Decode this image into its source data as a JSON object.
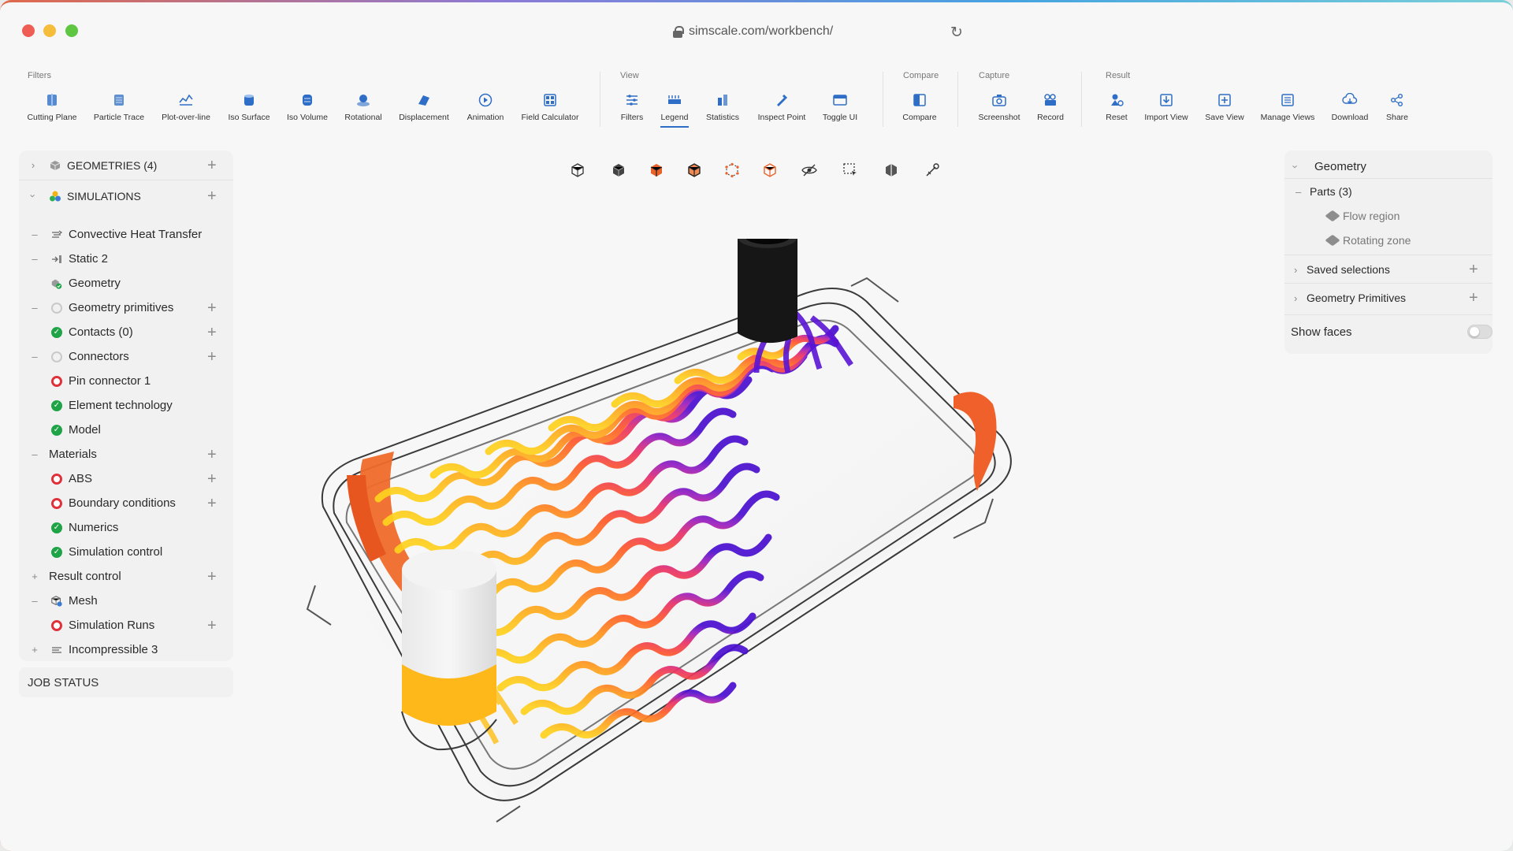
{
  "browser": {
    "url": "simscale.com/workbench/"
  },
  "toolbar": {
    "groups": [
      {
        "title": "Filters",
        "buttons": [
          {
            "label": "Cutting Plane",
            "icon": "cutting-plane-icon"
          },
          {
            "label": "Particle Trace",
            "icon": "particle-trace-icon"
          },
          {
            "label": "Plot-over-line",
            "icon": "plot-over-line-icon"
          },
          {
            "label": "Iso Surface",
            "icon": "iso-surface-icon"
          },
          {
            "label": "Iso Volume",
            "icon": "iso-volume-icon"
          },
          {
            "label": "Rotational",
            "icon": "rotational-icon"
          },
          {
            "label": "Displacement",
            "icon": "displacement-icon"
          },
          {
            "label": "Animation",
            "icon": "animation-icon"
          },
          {
            "label": "Field Calculator",
            "icon": "field-calculator-icon"
          }
        ]
      },
      {
        "title": "View",
        "buttons": [
          {
            "label": "Filters",
            "icon": "filters-icon"
          },
          {
            "label": "Legend",
            "icon": "legend-icon",
            "active": true
          },
          {
            "label": "Statistics",
            "icon": "statistics-icon"
          },
          {
            "label": "Inspect Point",
            "icon": "inspect-point-icon"
          },
          {
            "label": "Toggle UI",
            "icon": "toggle-ui-icon"
          }
        ]
      },
      {
        "title": "Compare",
        "buttons": [
          {
            "label": "Compare",
            "icon": "compare-icon"
          }
        ]
      },
      {
        "title": "Capture",
        "buttons": [
          {
            "label": "Screenshot",
            "icon": "screenshot-icon"
          },
          {
            "label": "Record",
            "icon": "record-icon"
          }
        ]
      },
      {
        "title": "Result",
        "buttons": [
          {
            "label": "Reset",
            "icon": "reset-icon"
          },
          {
            "label": "Import View",
            "icon": "import-view-icon"
          },
          {
            "label": "Save View",
            "icon": "save-view-icon"
          },
          {
            "label": "Manage Views",
            "icon": "manage-views-icon"
          },
          {
            "label": "Download",
            "icon": "download-icon"
          },
          {
            "label": "Share",
            "icon": "share-icon"
          }
        ]
      }
    ]
  },
  "tree": {
    "geometries_label": "GEOMETRIES (4)",
    "simulations_label": "SIMULATIONS",
    "items": [
      {
        "label": "Convective Heat Transfer",
        "status": "sim-type"
      },
      {
        "label": "Static 2",
        "status": "sim-type"
      },
      {
        "label": "Geometry",
        "status": "geometry"
      },
      {
        "label": "Geometry primitives",
        "status": "none"
      },
      {
        "label": "Contacts (0)",
        "status": "ok"
      },
      {
        "label": "Connectors",
        "status": "none"
      },
      {
        "label": "Pin connector 1",
        "status": "error"
      },
      {
        "label": "Element technology",
        "status": "ok"
      },
      {
        "label": "Model",
        "status": "ok"
      },
      {
        "label": "Materials",
        "status": "group"
      },
      {
        "label": "ABS",
        "status": "error"
      },
      {
        "label": "Boundary conditions",
        "status": "error"
      },
      {
        "label": "Numerics",
        "status": "ok"
      },
      {
        "label": "Simulation control",
        "status": "ok"
      },
      {
        "label": "Result control",
        "status": "group"
      },
      {
        "label": "Mesh",
        "status": "mesh"
      },
      {
        "label": "Simulation Runs",
        "status": "error"
      },
      {
        "label": "Incompressible 3",
        "status": "sim-type"
      }
    ],
    "job_status_label": "JOB STATUS"
  },
  "right_panel": {
    "geometry_label": "Geometry",
    "parts_label": "Parts (3)",
    "parts": [
      "Flow region",
      "Rotating zone"
    ],
    "saved_selections_label": "Saved selections",
    "geometry_primitives_label": "Geometry Primitives",
    "show_faces_label": "Show faces",
    "show_faces_on": false
  },
  "view_tools": [
    "iso-view-icon",
    "solid-cube-icon",
    "orange-cube-icon",
    "orange-edge-cube-icon",
    "vertex-cube-icon",
    "wire-cube-icon",
    "hide-icon",
    "box-select-icon",
    "section-cube-icon",
    "measure-icon"
  ],
  "colors": {
    "accent": "#2f6ec6",
    "ok": "#1ea446",
    "error": "#e0313b",
    "flow_cold": "#ffd21f",
    "flow_mid": "#ff7a1a",
    "flow_warm": "#e8306a",
    "flow_hot": "#4a0fd0"
  }
}
